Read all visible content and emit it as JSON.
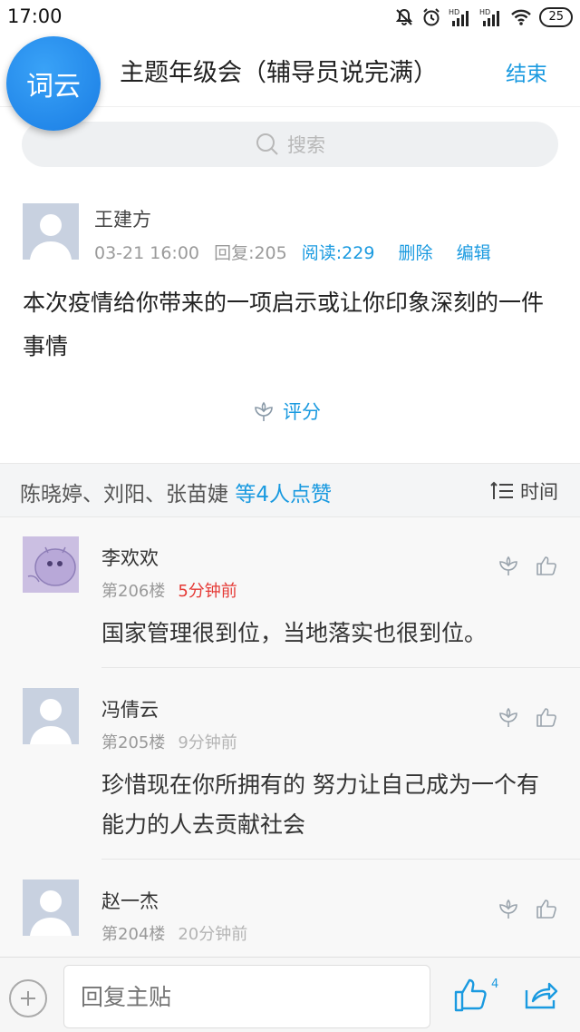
{
  "status": {
    "time": "17:00",
    "battery": "25"
  },
  "app": {
    "logo_text": "词云",
    "title": "主题年级会（辅导员说完满）",
    "end_label": "结束"
  },
  "search": {
    "placeholder": "搜索"
  },
  "post": {
    "author": "王建方",
    "date": "03-21 16:00",
    "replies": "回复:205",
    "reads": "阅读:229",
    "delete_label": "删除",
    "edit_label": "编辑",
    "body": "本次疫情给你带来的一项启示或让你印象深刻的一件事情",
    "rate_label": "评分"
  },
  "likes": {
    "names": "陈晓婷、刘阳、张苗婕",
    "count_text": "等4人点赞",
    "sort_label": "时间"
  },
  "replies": [
    {
      "author": "李欢欢",
      "floor": "第206楼",
      "time": "5分钟前",
      "text": "国家管理很到位，当地落实也很到位。"
    },
    {
      "author": "冯倩云",
      "floor": "第205楼",
      "time": "9分钟前",
      "text": "珍惜现在你所拥有的  努力让自己成为一个有能力的人去贡献社会"
    },
    {
      "author": "赵一杰",
      "floor": "第204楼",
      "time": "20分钟前",
      "text": ""
    }
  ],
  "bottom": {
    "reply_placeholder": "回复主贴",
    "like_count": "4"
  },
  "colors": {
    "accent": "#1a9ae0",
    "recent_time": "#e53935",
    "logo_bg": "#1a7de4"
  }
}
